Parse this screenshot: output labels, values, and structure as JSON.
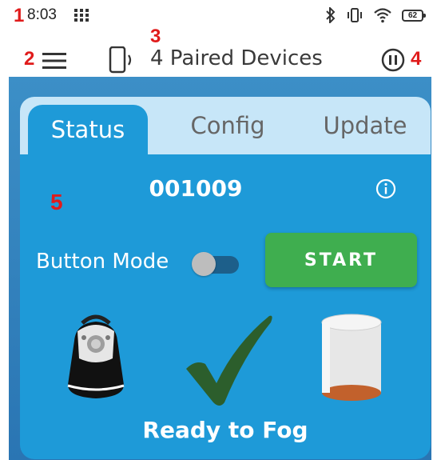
{
  "status_bar": {
    "time": "8:03",
    "battery": "62",
    "icons": [
      "app-grid-icon",
      "bluetooth-icon",
      "vibrate-icon",
      "wifi-icon",
      "battery-icon"
    ]
  },
  "annotations": [
    "1",
    "2",
    "3",
    "4",
    "5"
  ],
  "app_bar": {
    "title": "4 Paired Devices",
    "icons": [
      "menu-icon",
      "phone-signal-icon",
      "pause-icon"
    ]
  },
  "tabs": [
    {
      "label": "Status",
      "active": true
    },
    {
      "label": "Config",
      "active": false
    },
    {
      "label": "Update",
      "active": false
    }
  ],
  "status_panel": {
    "device_id": "001009",
    "button_mode_label": "Button Mode",
    "button_mode_on": false,
    "start_label": "START",
    "status_text": "Ready to Fog"
  },
  "colors": {
    "card": "#1e9ad8",
    "tabbar": "#c7e6f8",
    "start": "#3fae4f",
    "check": "#2c5e2c",
    "annotation": "#e01b1b"
  }
}
